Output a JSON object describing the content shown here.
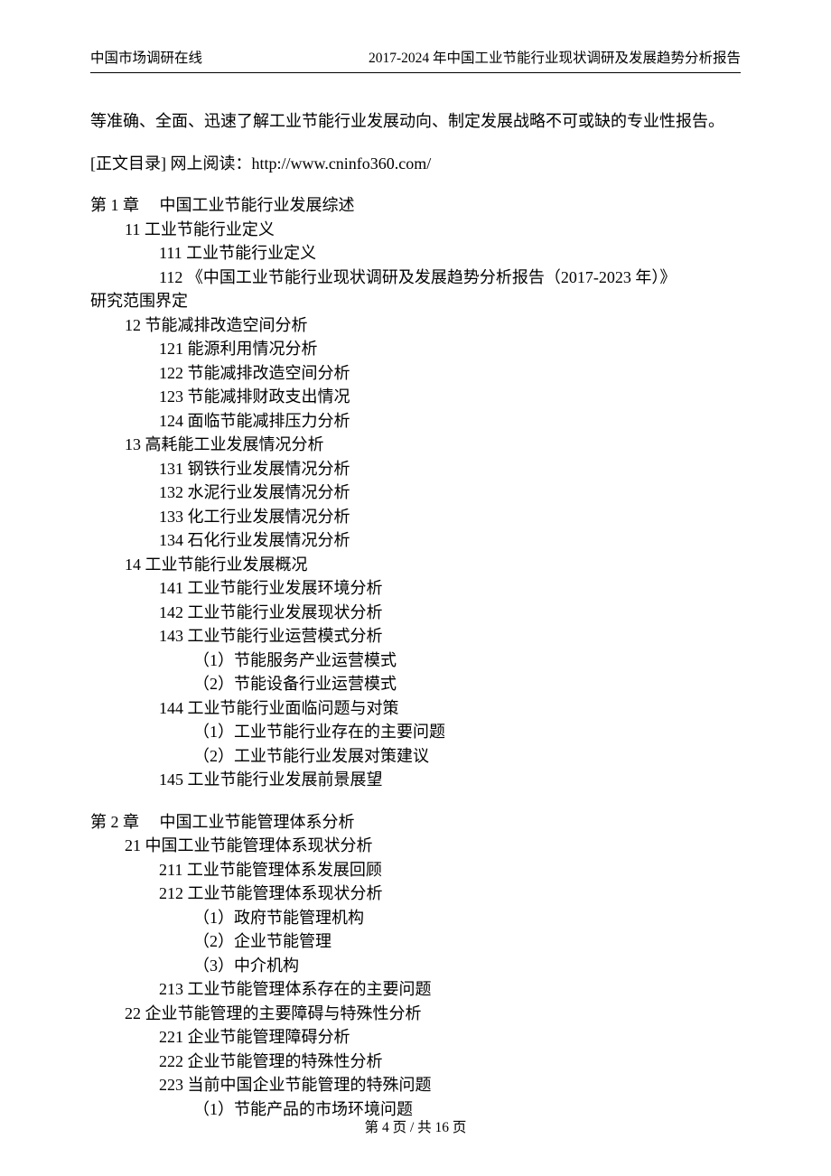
{
  "header": {
    "left": "中国市场调研在线",
    "right": "2017-2024 年中国工业节能行业现状调研及发展趋势分析报告"
  },
  "intro": "等准确、全面、迅速了解工业节能行业发展动向、制定发展战略不可或缺的专业性报告。",
  "link_line": "[正文目录] 网上阅读：http://www.cninfo360.com/",
  "toc": [
    {
      "level": 0,
      "text": "第 1 章　 中国工业节能行业发展综述"
    },
    {
      "level": 1,
      "text": "11 工业节能行业定义"
    },
    {
      "level": 2,
      "text": "111 工业节能行业定义"
    },
    {
      "level": 2,
      "text": "112 《中国工业节能行业现状调研及发展趋势分析报告（2017-2023 年）》"
    },
    {
      "level": -1,
      "text": "研究范围界定"
    },
    {
      "level": 1,
      "text": "12 节能减排改造空间分析"
    },
    {
      "level": 2,
      "text": "121 能源利用情况分析"
    },
    {
      "level": 2,
      "text": "122 节能减排改造空间分析"
    },
    {
      "level": 2,
      "text": "123 节能减排财政支出情况"
    },
    {
      "level": 2,
      "text": "124 面临节能减排压力分析"
    },
    {
      "level": 1,
      "text": "13 高耗能工业发展情况分析"
    },
    {
      "level": 2,
      "text": "131 钢铁行业发展情况分析"
    },
    {
      "level": 2,
      "text": "132 水泥行业发展情况分析"
    },
    {
      "level": 2,
      "text": "133 化工行业发展情况分析"
    },
    {
      "level": 2,
      "text": "134 石化行业发展情况分析"
    },
    {
      "level": 1,
      "text": "14 工业节能行业发展概况"
    },
    {
      "level": 2,
      "text": "141 工业节能行业发展环境分析"
    },
    {
      "level": 2,
      "text": "142 工业节能行业发展现状分析"
    },
    {
      "level": 2,
      "text": "143 工业节能行业运营模式分析"
    },
    {
      "level": 3,
      "text": "（1）节能服务产业运营模式"
    },
    {
      "level": 3,
      "text": "（2）节能设备行业运营模式"
    },
    {
      "level": 2,
      "text": "144 工业节能行业面临问题与对策"
    },
    {
      "level": 3,
      "text": "（1）工业节能行业存在的主要问题"
    },
    {
      "level": 3,
      "text": "（2）工业节能行业发展对策建议"
    },
    {
      "level": 2,
      "text": "145 工业节能行业发展前景展望"
    }
  ],
  "toc2": [
    {
      "level": 0,
      "text": "第 2 章　 中国工业节能管理体系分析"
    },
    {
      "level": 1,
      "text": "21 中国工业节能管理体系现状分析"
    },
    {
      "level": 2,
      "text": "211 工业节能管理体系发展回顾"
    },
    {
      "level": 2,
      "text": "212 工业节能管理体系现状分析"
    },
    {
      "level": 3,
      "text": "（1）政府节能管理机构"
    },
    {
      "level": 3,
      "text": "（2）企业节能管理"
    },
    {
      "level": 3,
      "text": "（3）中介机构"
    },
    {
      "level": 2,
      "text": "213 工业节能管理体系存在的主要问题"
    },
    {
      "level": 1,
      "text": "22 企业节能管理的主要障碍与特殊性分析"
    },
    {
      "level": 2,
      "text": "221 企业节能管理障碍分析"
    },
    {
      "level": 2,
      "text": "222 企业节能管理的特殊性分析"
    },
    {
      "level": 2,
      "text": "223 当前中国企业节能管理的特殊问题"
    },
    {
      "level": 3,
      "text": "（1）节能产品的市场环境问题"
    }
  ],
  "footer": "第 4 页 / 共 16 页"
}
